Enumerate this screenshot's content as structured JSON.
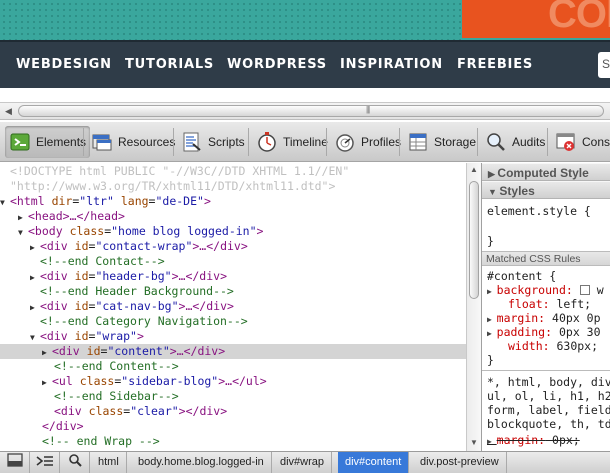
{
  "site": {
    "logo_text": "COF",
    "nav": [
      "WEBDESIGN",
      "TUTORIALS",
      "WORDPRESS",
      "INSPIRATION",
      "FREEBIES"
    ],
    "search_value": "S",
    "scrollbar_grip": "|||",
    "colors": {
      "banner": "#3aa79d",
      "logo": "#e8531f",
      "nav_bg": "#2f3c48"
    }
  },
  "devtools": {
    "tabs": [
      {
        "label": "Elements",
        "icon": "elements-icon",
        "active": true
      },
      {
        "label": "Resources",
        "icon": "resources-icon"
      },
      {
        "label": "Scripts",
        "icon": "scripts-icon"
      },
      {
        "label": "Timeline",
        "icon": "timeline-icon"
      },
      {
        "label": "Profiles",
        "icon": "profiles-icon"
      },
      {
        "label": "Storage",
        "icon": "storage-icon"
      },
      {
        "label": "Audits",
        "icon": "audits-icon"
      },
      {
        "label": "Console",
        "icon": "console-icon"
      }
    ],
    "dom": {
      "doctype1": "<!DOCTYPE html PUBLIC \"-//W3C//DTD XHTML 1.1//EN\"",
      "doctype2": "\"http://www.w3.org/TR/xhtml11/DTD/xhtml11.dtd\">",
      "html_tag": "<html",
      "html_attr1": "dir",
      "html_val1": "\"ltr\"",
      "html_attr2": "lang",
      "html_val2": "\"de-DE\"",
      "head": "<head>…</head>",
      "body_attr": "class",
      "body_val": "\"home blog logged-in\"",
      "contact_id": "\"contact-wrap\"",
      "comment_contact": "<!--end Contact-->",
      "headerbg_id": "\"header-bg\"",
      "comment_header": "<!--end Header Background-->",
      "catnav_id": "\"cat-nav-bg\"",
      "comment_cat": "<!--end Category Navigation-->",
      "wrap_id": "\"wrap\"",
      "content_id": "\"content\"",
      "comment_content": "<!--end Content-->",
      "ul_class": "\"sidebar-blog\"",
      "comment_sidebar": "<!--end Sidebar-->",
      "clear_class": "\"clear\"",
      "comment_wrap": "<!-- end Wrap -->"
    },
    "sidebar": {
      "computed_style": "Computed Style",
      "styles": "Styles",
      "element_style": "element.style {",
      "close_brace": "}",
      "matched_rules": "Matched CSS Rules",
      "content_selector": "#content {",
      "rules": [
        {
          "prop": "background:",
          "value": "w",
          "expandable": true,
          "swatch": true
        },
        {
          "prop": "float:",
          "value": "left;",
          "expandable": false
        },
        {
          "prop": "margin:",
          "value": "40px 0p",
          "expandable": true
        },
        {
          "prop": "padding:",
          "value": "0px 30",
          "expandable": true
        },
        {
          "prop": "width:",
          "value": "630px;",
          "expandable": false
        }
      ],
      "reset_selector_lines": [
        "*, html, body, div",
        "ul, ol, li, h1, h2",
        "form, label, field",
        "blockquote, th, td"
      ],
      "reset_margin_prop": "margin:",
      "reset_margin_value": "0px;"
    },
    "breadcrumbs": [
      "html",
      "body.home.blog.logged-in",
      "div#wrap",
      "div#content",
      "div.post-preview"
    ],
    "active_crumb": "div#content"
  }
}
